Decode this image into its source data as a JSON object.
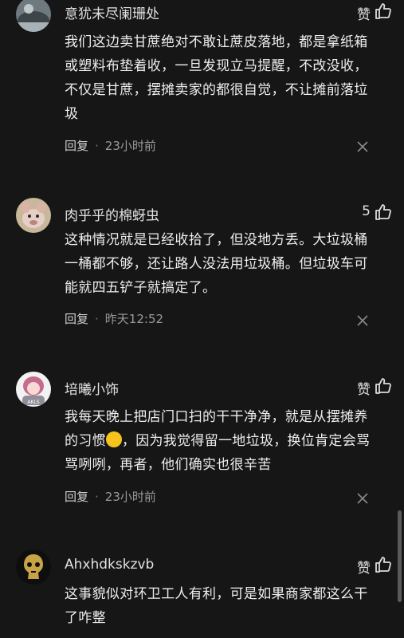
{
  "comments": [
    {
      "author": "意犹未尽阑珊处",
      "like": "赞",
      "text": "我们这边卖甘蔗绝对不敢让蔗皮落地，都是拿纸箱或塑料布垫着收，一旦发现立马提醒，不改没收，不仅是甘蔗，摆摊卖家的都很自觉，不让摊前落垃圾",
      "reply_label": "回复",
      "time": "23小时前"
    },
    {
      "author": "肉乎乎的棉蚜虫",
      "like": "5",
      "text": "这种情况就是已经收拾了，但没地方丢。大垃圾桶一桶都不够，还让路人没法用垃圾桶。但垃圾车可能就四五铲子就搞定了。",
      "reply_label": "回复",
      "time": "昨天12:52"
    },
    {
      "author": "培曦小饰",
      "like": "赞",
      "text_before": "我每天晚上把店门口扫的干干净净，就是从摆摊养的习惯",
      "text_after": "，因为我觉得留一地垃圾，换位肯定会骂骂咧咧，再者，他们确实也很辛苦",
      "reply_label": "回复",
      "time": "23小时前"
    },
    {
      "author": "Ahxhdkskzvb",
      "like": "赞",
      "text": "这事貌似对环卫工人有利，可是如果商家都这么干了咋整"
    }
  ],
  "icons": {
    "like": "thumbs-up-icon",
    "dismiss": "close-icon",
    "emoji": "strong-arm-emoji"
  },
  "colors": {
    "background": "#161616",
    "text": "#eeeeee",
    "meta": "#9a9a9a"
  }
}
